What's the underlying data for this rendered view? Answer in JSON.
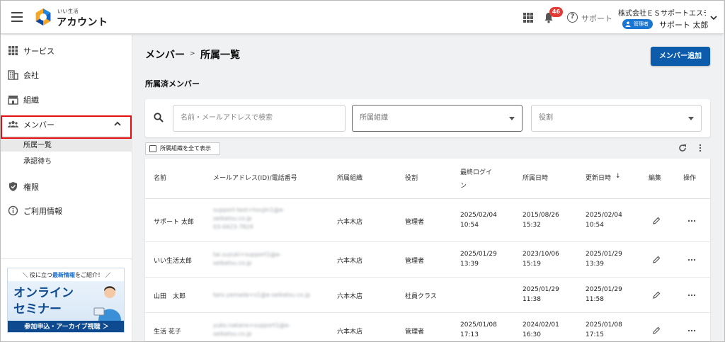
{
  "header": {
    "logo_sub": "いい生活",
    "logo_main": "アカウント",
    "notification_count": "46",
    "support_label": "サポート",
    "company_name": "株式会社ＥＳサポートエステート",
    "role_badge": "管理者",
    "user_name": "サポート 太郎"
  },
  "sidebar": {
    "items": [
      {
        "label": "サービス",
        "icon": "apps-icon"
      },
      {
        "label": "会社",
        "icon": "building-icon"
      },
      {
        "label": "組織",
        "icon": "organization-icon"
      },
      {
        "label": "メンバー",
        "icon": "people-icon"
      },
      {
        "label": "権限",
        "icon": "shield-icon"
      },
      {
        "label": "ご利用情報",
        "icon": "info-icon"
      }
    ],
    "sub_items": [
      {
        "label": "所属一覧"
      },
      {
        "label": "承認待ち"
      }
    ],
    "banner": {
      "top_pre": "＼ 役に立つ",
      "top_emph": "最新情報",
      "top_post": "をご紹介！ ／",
      "title1": "オンライン",
      "title2": "セミナー",
      "cta": "参加申込・アーカイブ視聴 ＞"
    }
  },
  "main": {
    "breadcrumb_parent": "メンバー",
    "breadcrumb_sep": ">",
    "breadcrumb_current": "所属一覧",
    "add_button": "メンバー追加",
    "section_title": "所属済メンバー",
    "filters": {
      "search_placeholder": "名前・メールアドレスで検索",
      "org_placeholder": "所属組織",
      "role_placeholder": "役割"
    },
    "show_all_label": "所属組織を全て表示",
    "table": {
      "headers": {
        "name": "名前",
        "email": "メールアドレス(ID)/電話番号",
        "org": "所属組織",
        "role": "役割",
        "last_login_1": "最終ログイ",
        "last_login_2": "ン",
        "joined": "所属日時",
        "updated": "更新日時",
        "sort_arrow": "↓",
        "edit": "編集",
        "action": "操作"
      },
      "rows": [
        {
          "name": "サポート 太郎",
          "email_1": "support-test+houjin1@e-",
          "email_2": "seikatsu.co.jp",
          "email_3": "03-0423-7824",
          "org": "六本木店",
          "role": "管理者",
          "last_login_1": "2025/02/04",
          "last_login_2": "10:54",
          "joined_1": "2015/08/26",
          "joined_2": "15:32",
          "updated_1": "2025/02/04",
          "updated_2": "10:54"
        },
        {
          "name": "いい生活太郎",
          "email_1": "tai.suzuki+support1@e-",
          "email_2": "seikatsu.co.jp",
          "email_3": "",
          "org": "六本木店",
          "role": "管理者",
          "last_login_1": "2025/01/29",
          "last_login_2": "13:39",
          "joined_1": "2023/10/06",
          "joined_2": "15:19",
          "updated_1": "2025/01/29",
          "updated_2": "13:39"
        },
        {
          "name": "山田　太郎",
          "email_1": "taro.yamada+s1@e-seikatsu.co.jp",
          "email_2": "",
          "email_3": "",
          "org": "六本木店",
          "role": "社員クラス",
          "last_login_1": "",
          "last_login_2": "",
          "joined_1": "2025/01/29",
          "joined_2": "11:38",
          "updated_1": "2025/01/29",
          "updated_2": "11:58"
        },
        {
          "name": "生活 花子",
          "email_1": "yuko.nakano+support1@e-",
          "email_2": "seikatsu.co.jp",
          "email_3": "",
          "org": "六本木店",
          "role": "管理者",
          "last_login_1": "2025/01/08",
          "last_login_2": "17:13",
          "joined_1": "2024/02/01",
          "joined_2": "16:30",
          "updated_1": "2025/01/08",
          "updated_2": "17:15"
        }
      ]
    }
  }
}
